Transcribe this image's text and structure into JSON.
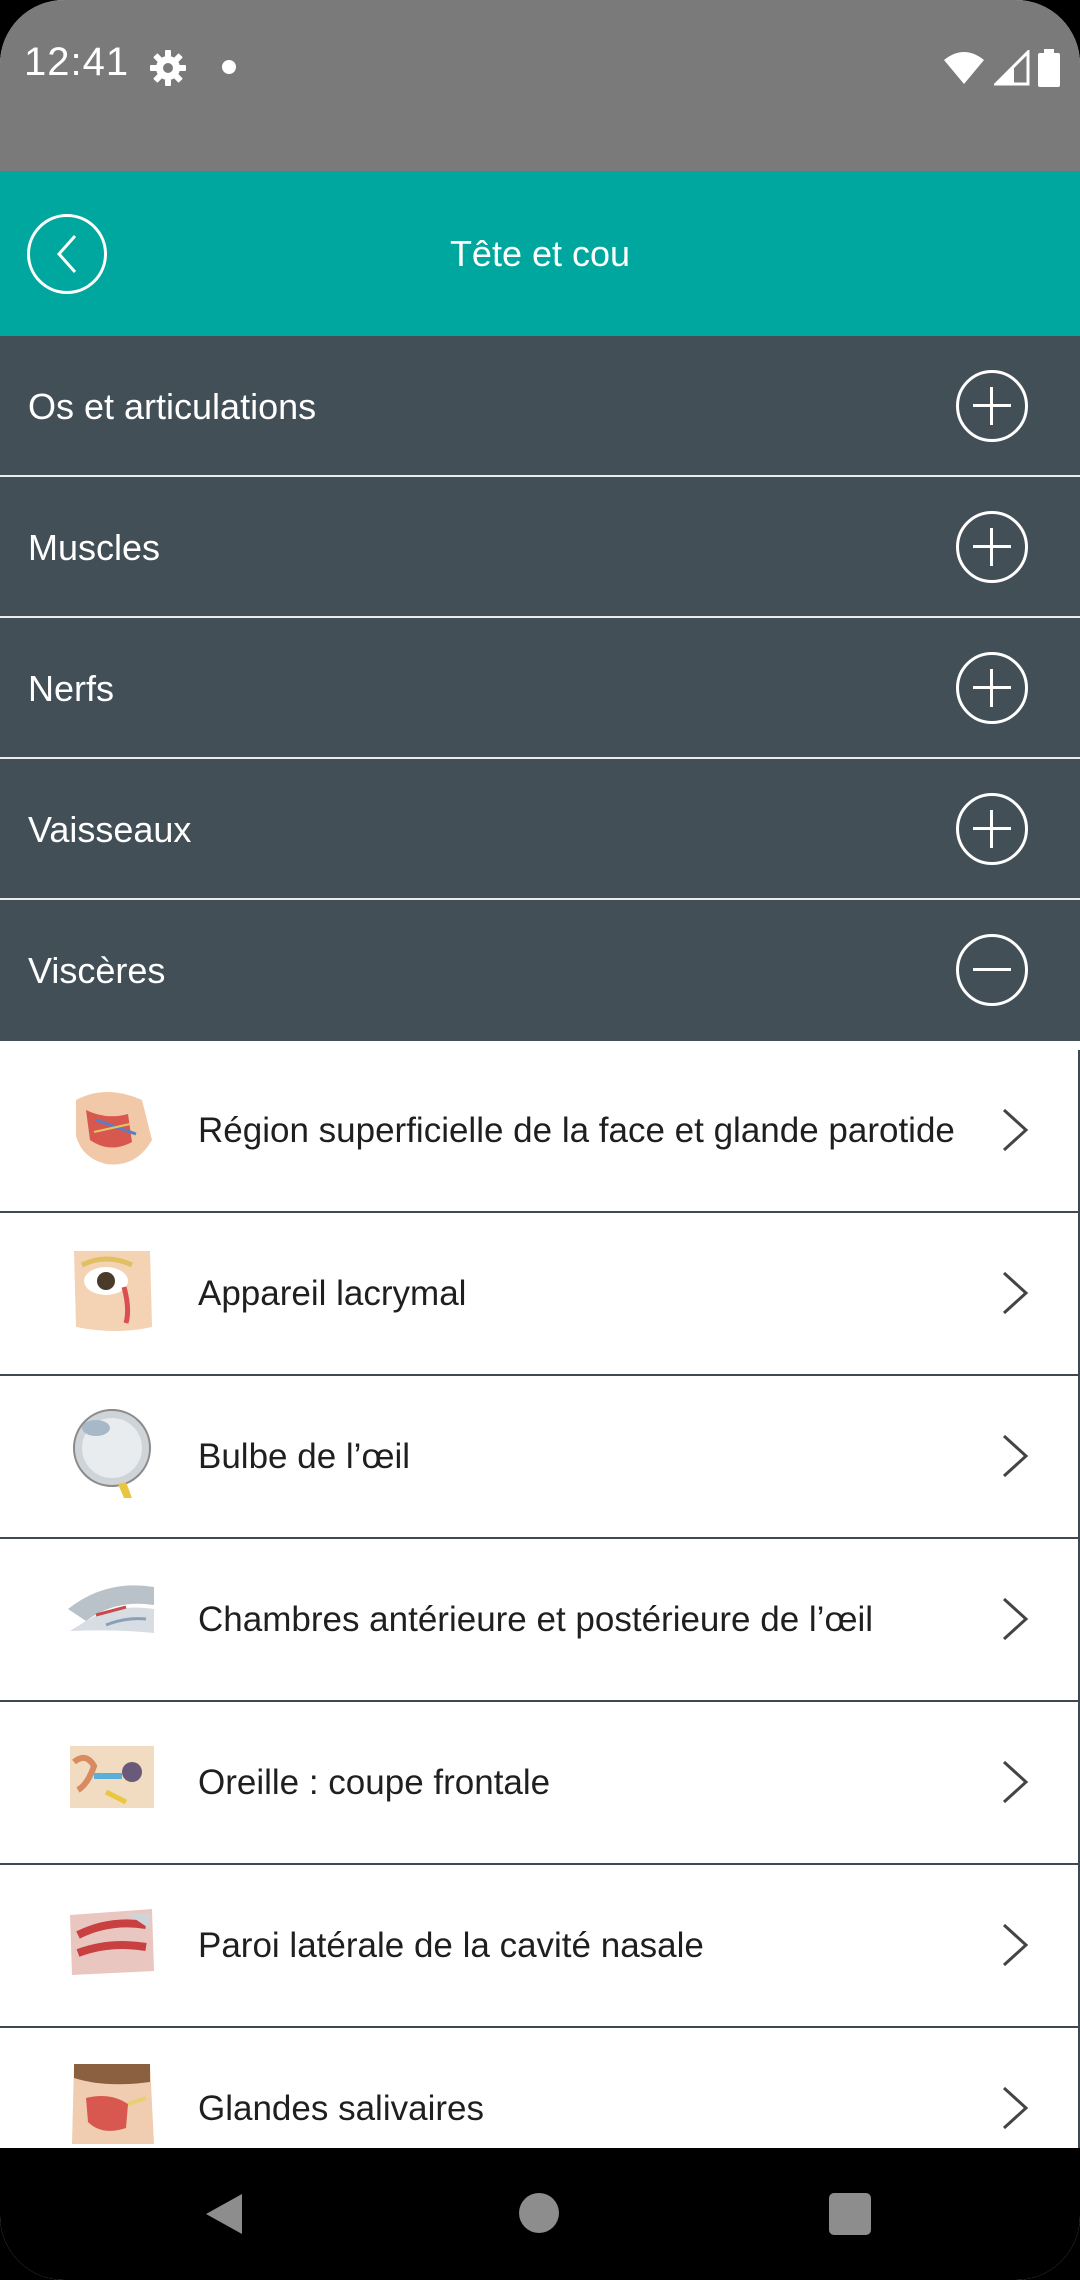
{
  "status_bar": {
    "time": "12:41",
    "icons": [
      "gear-icon",
      "notification-dot-icon",
      "wifi-icon",
      "cell-signal-icon",
      "battery-icon"
    ]
  },
  "header": {
    "title": "Tête et cou",
    "back_icon": "chevron-left-icon",
    "background": "#00a79e"
  },
  "categories": [
    {
      "label": "Os et articulations",
      "state": "collapsed"
    },
    {
      "label": "Muscles",
      "state": "collapsed"
    },
    {
      "label": "Nerfs",
      "state": "collapsed"
    },
    {
      "label": "Vaisseaux",
      "state": "collapsed"
    },
    {
      "label": "Viscères",
      "state": "expanded"
    }
  ],
  "category_colors": {
    "background": "#434f57",
    "text": "#ffffff"
  },
  "items": [
    {
      "label": "Région superficielle de la face et glande parotide",
      "thumbnail": "face-parotid-illustration"
    },
    {
      "label": "Appareil lacrymal",
      "thumbnail": "lacrimal-apparatus-illustration"
    },
    {
      "label": "Bulbe de l’œil",
      "thumbnail": "eyeball-illustration"
    },
    {
      "label": "Chambres antérieure et postérieure de l’œil",
      "thumbnail": "eye-chambers-illustration"
    },
    {
      "label": "Oreille : coupe frontale",
      "thumbnail": "ear-section-illustration"
    },
    {
      "label": "Paroi latérale de la cavité nasale",
      "thumbnail": "nasal-cavity-illustration"
    },
    {
      "label": "Glandes salivaires",
      "thumbnail": "salivary-glands-illustration"
    }
  ],
  "nav_bar": {
    "buttons": [
      "back-triangle-icon",
      "home-circle-icon",
      "recents-square-icon"
    ]
  }
}
